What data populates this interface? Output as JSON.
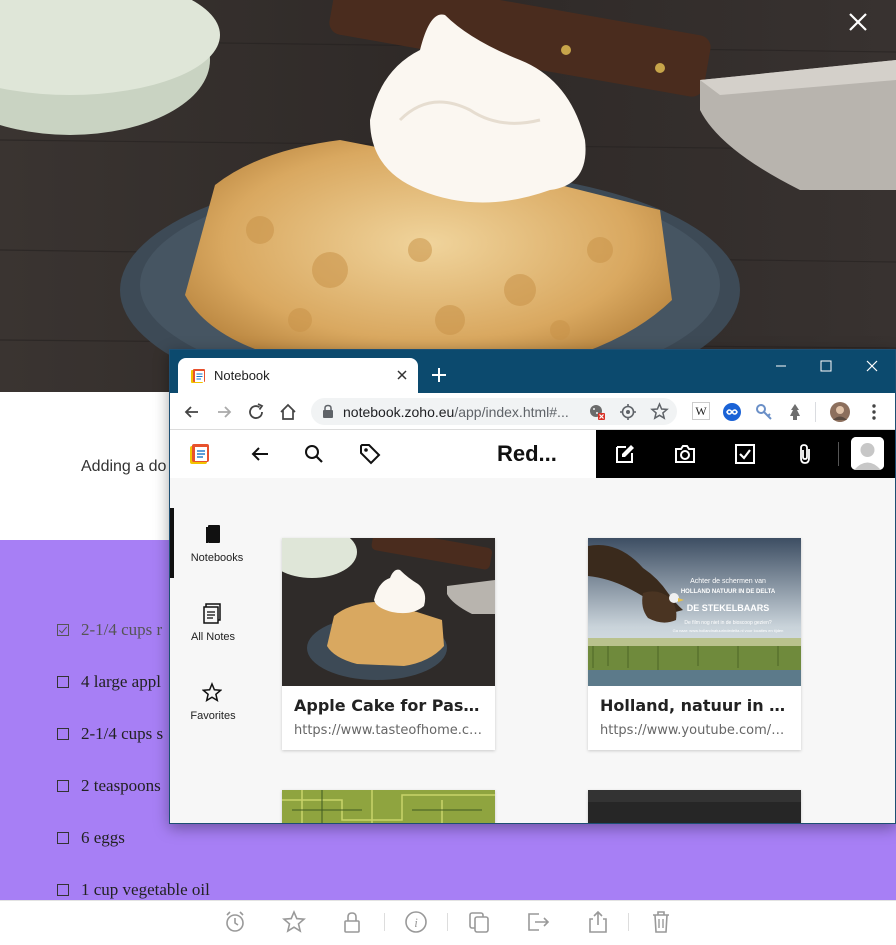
{
  "background_page": {
    "intro_text": "Adding a do",
    "ingredients": [
      {
        "text": "2-1/4 cups r",
        "checked": true
      },
      {
        "text": "4 large appl",
        "checked": false
      },
      {
        "text": "2-1/4 cups s",
        "checked": false
      },
      {
        "text": "2 teaspoons",
        "checked": false
      },
      {
        "text": "6 eggs",
        "checked": false
      },
      {
        "text": "1 cup vegetable oil",
        "checked": false
      }
    ],
    "colors": {
      "ingredients_bg": "#a77ff5"
    },
    "bottom_bar_icons": [
      "alarm-icon",
      "star-icon",
      "lock-icon",
      "info-icon",
      "copy-icon",
      "move-icon",
      "share-icon",
      "trash-icon"
    ]
  },
  "browser": {
    "tab_title": "Notebook",
    "new_tab": "+",
    "url_host": "notebook.zoho.eu",
    "url_path": "/app/index.html#...",
    "extension_label_w": "W",
    "window_controls": [
      "minimize",
      "maximize",
      "close"
    ],
    "colors": {
      "titlebar": "#0c4a6e"
    }
  },
  "notebook_app": {
    "header_title": "Red...",
    "sidebar": [
      {
        "label": "Notebooks",
        "icon": "notebook-icon",
        "active": true
      },
      {
        "label": "All Notes",
        "icon": "all-notes-icon",
        "active": false
      },
      {
        "label": "Favorites",
        "icon": "star-icon",
        "active": false
      }
    ],
    "cards": [
      {
        "title": "Apple Cake for Passo...",
        "url": "https://www.tasteofhome.co..."
      },
      {
        "title": "Holland, natuur in de ...",
        "url": "https://www.youtube.com/w..."
      }
    ],
    "card2_overlay": {
      "line1": "Achter de schermen van",
      "line2": "HOLLAND NATUUR IN DE DELTA",
      "line3": "DE STEKELBAARS",
      "line4": "De film nog niet in de bioscoop gezien?",
      "line5": "Ga naar: www.hollandnatuurindedelta.nl voor locaties en tijden"
    }
  }
}
